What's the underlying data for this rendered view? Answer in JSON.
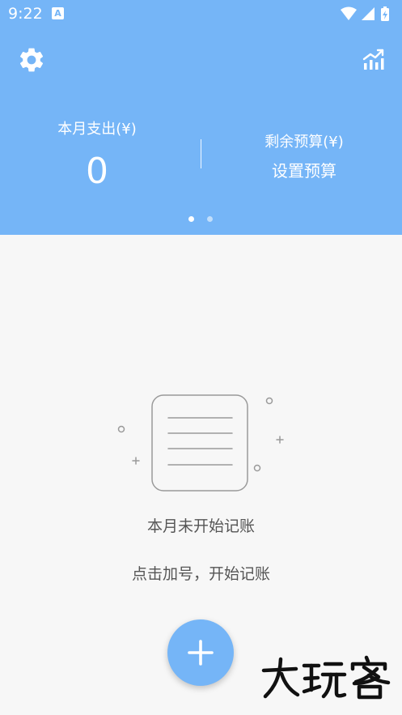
{
  "status_bar": {
    "time": "9:22",
    "app_icon": "A"
  },
  "header": {
    "settings_icon": "gear-icon",
    "stats_icon": "trend-chart-icon",
    "month_expense_label": "本月支出(¥)",
    "month_expense_value": "0",
    "remaining_budget_label": "剩余预算(¥)",
    "set_budget_action": "设置预算",
    "pager": {
      "count": 2,
      "active_index": 0
    }
  },
  "empty_state": {
    "icon": "document-lines-icon",
    "title": "本月未开始记账",
    "hint": "点击加号，开始记账"
  },
  "fab": {
    "icon": "plus-icon"
  },
  "watermark": {
    "text": "大玩客"
  },
  "colors": {
    "primary": "#75b5f7",
    "background": "#f7f7f7",
    "text_secondary": "#555555"
  }
}
